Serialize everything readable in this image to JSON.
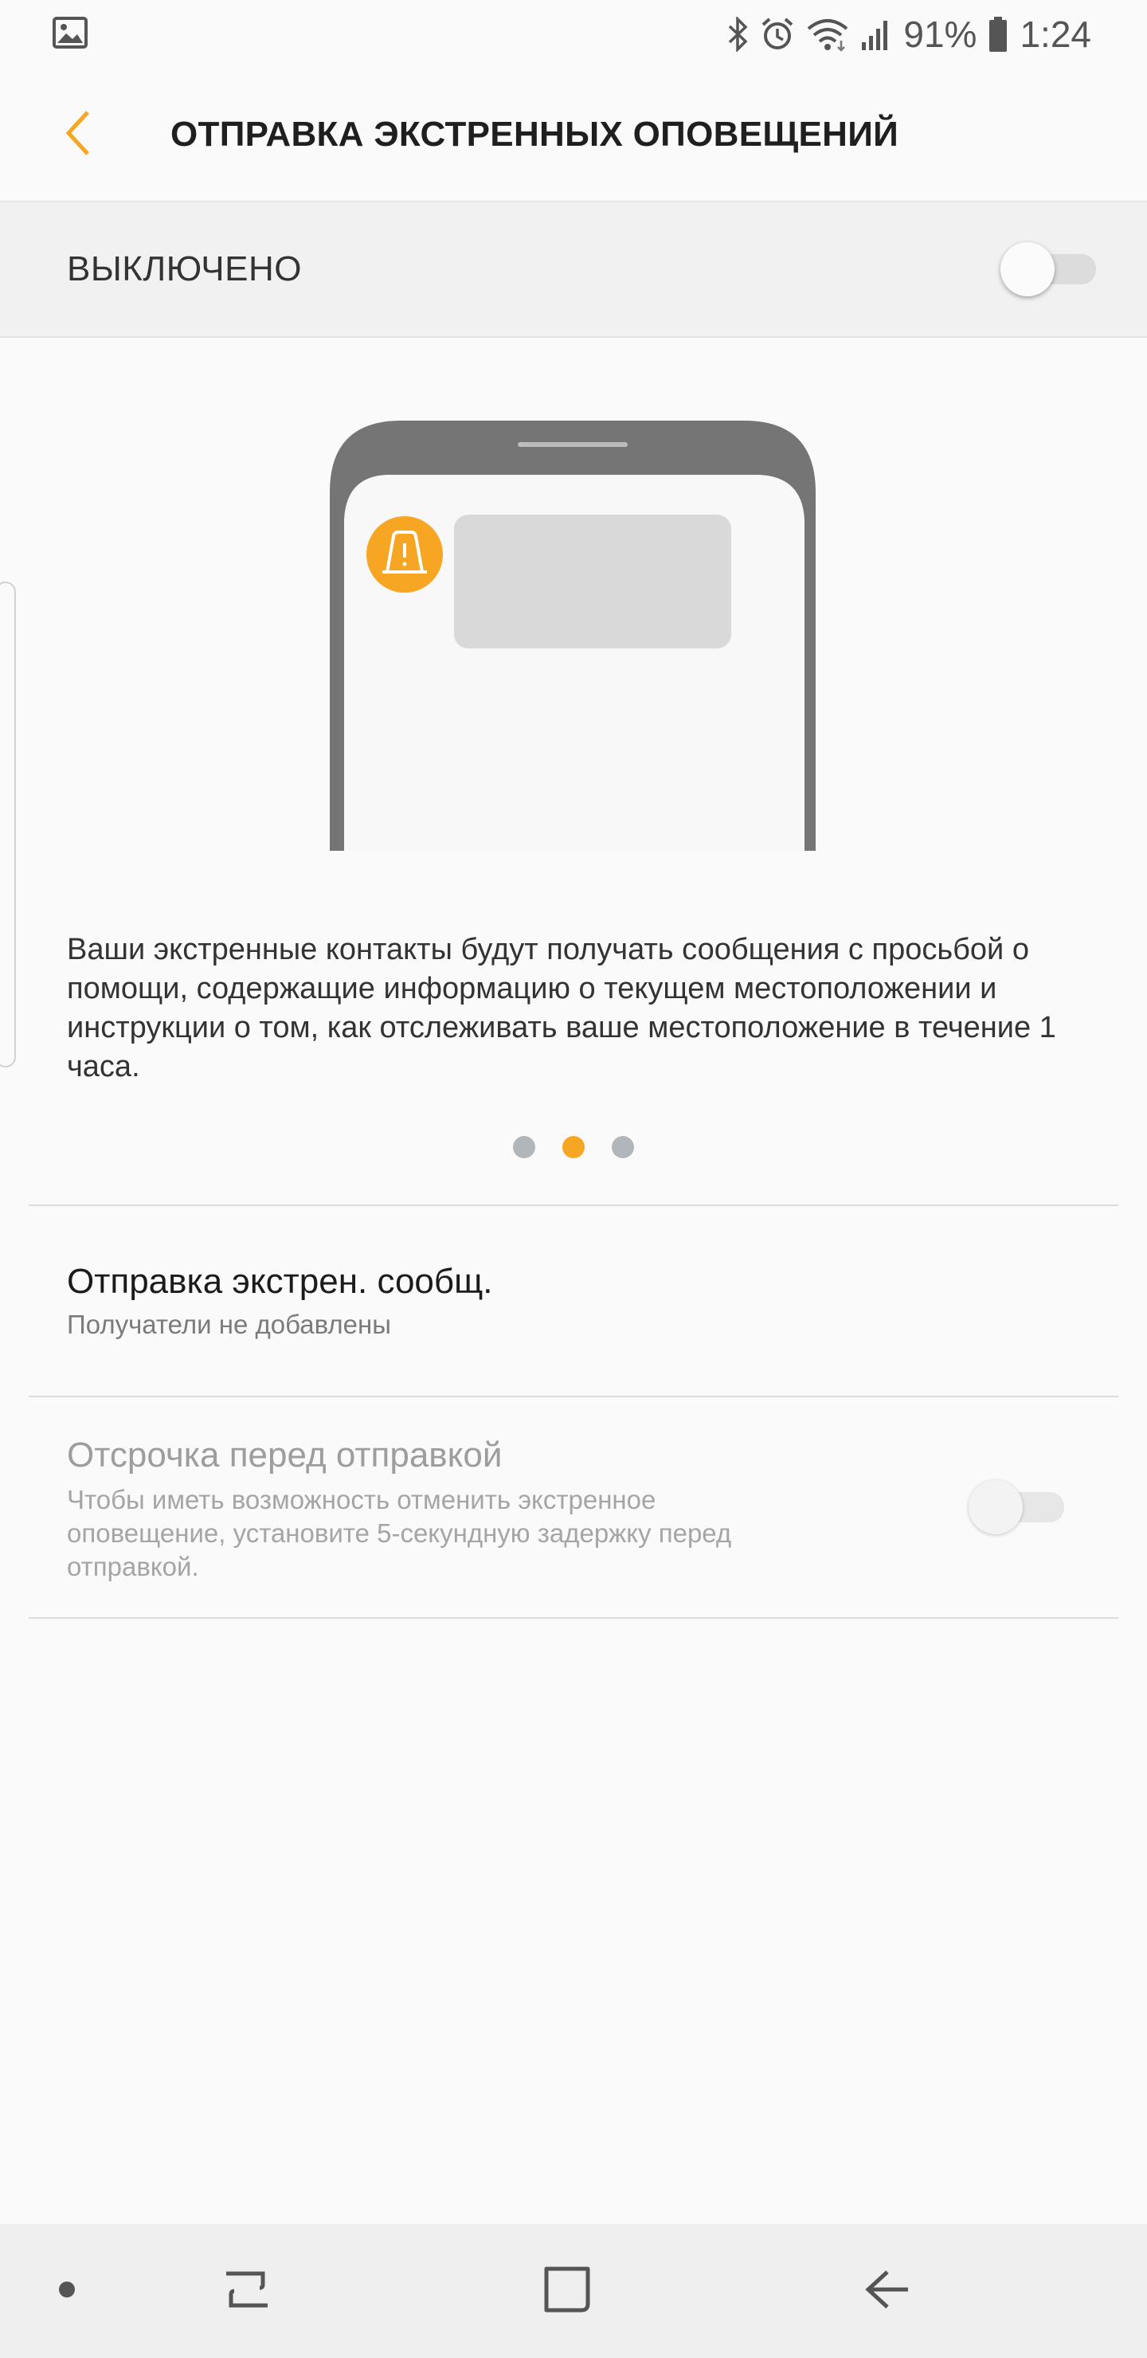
{
  "status_bar": {
    "battery_percent": "91%",
    "time": "1:24",
    "icons": [
      "gallery-icon",
      "bluetooth-icon",
      "alarm-icon",
      "wifi-icon",
      "signal-icon",
      "battery-icon"
    ]
  },
  "app_bar": {
    "title": "ОТПРАВКА ЭКСТРЕННЫХ ОПОВЕЩЕНИЙ",
    "back_icon": "chevron-left-icon"
  },
  "master_switch": {
    "label": "ВЫКЛЮЧЕНО",
    "checked": false
  },
  "illustration": {
    "icon": "warning-icon"
  },
  "description": "Ваши экстренные контакты будут получать сообщения с просьбой о помощи, содержащие информацию о текущем местоположении и инструкции о том, как отслеживать ваше местоположение в течение 1 часа.",
  "pager": {
    "count": 3,
    "active_index": 1
  },
  "settings": [
    {
      "title": "Отправка экстрен. сообщ.",
      "subtitle": "Получатели не добавлены",
      "enabled": true
    },
    {
      "title": "Отсрочка перед отправкой",
      "subtitle": "Чтобы иметь возможность отменить экстренное оповещение, установите 5-секундную задержку перед отправкой.",
      "enabled": false,
      "checked": false
    }
  ],
  "nav_bar": {
    "buttons": [
      "dot-icon",
      "recent-apps-icon",
      "home-icon",
      "back-arrow-icon"
    ]
  },
  "colors": {
    "accent": "#f6a623",
    "background": "#fafafa",
    "master_bg": "#f1f1f1",
    "phone_frame": "#757575",
    "dot_inactive": "#b1b6ba"
  }
}
